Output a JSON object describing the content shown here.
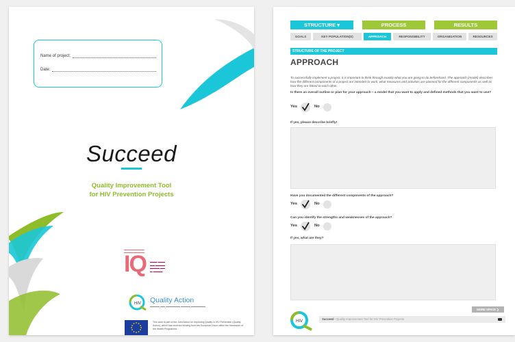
{
  "cover": {
    "name_label": "Name of project:",
    "date_label": "Date:",
    "title": "Succeed",
    "subtitle_line1": "Quality Improvement Tool",
    "subtitle_line2": "for HIV Prevention Projects",
    "iq_logo": "IQ",
    "qa_logo": "Quality Action",
    "eu_text": "This work is part of the Joint Action on Improving Quality in HIV Prevention (Quality Action), which has received funding from the European Union within the framework of the Health Programme."
  },
  "worksheet": {
    "nav": [
      "STRUCTURE ▾",
      "PROCESS",
      "RESULTS"
    ],
    "tabs": [
      "GOALS",
      "KEY POPULATION(S)",
      "APPROACH",
      "RESPONSIBILITY",
      "ORGANISATION",
      "RESOURCES"
    ],
    "section_bar": "STRUCTURE OF THE PROJECT",
    "title": "APPROACH",
    "intro": "To successfully implement a project, it is important to think through exactly what you are going to do beforehand. The approach (model) describes how the different components of a project are intended to work, what measures and activities are planned for the different components as well as how they are linked to each other.",
    "q1": "Is there an overall outline or plan for your approach – a model that you want to apply and defined methods that you want to use?",
    "q1_prompt": "If yes, please describe briefly!",
    "q2": "Have you documented the different components of the approach?",
    "q3": "Can you identify the strengths and weaknesses of the approach?",
    "q3_prompt": "If yes, what are they?",
    "yes": "Yes",
    "no": "No",
    "more_space": "MORE SPACE ❯",
    "footer_brand": "Succeed",
    "footer_text": "• Quality Improvement Tool for HIV Prevention Projects"
  },
  "colors": {
    "accent_cyan": "#1bc6d8",
    "accent_green": "#9ec838",
    "subtitle_green": "#8fbd2a"
  },
  "icons": [
    "check-icon",
    "radio-icon",
    "print-icon",
    "eu-flag-icon",
    "quality-action-logo-icon"
  ]
}
